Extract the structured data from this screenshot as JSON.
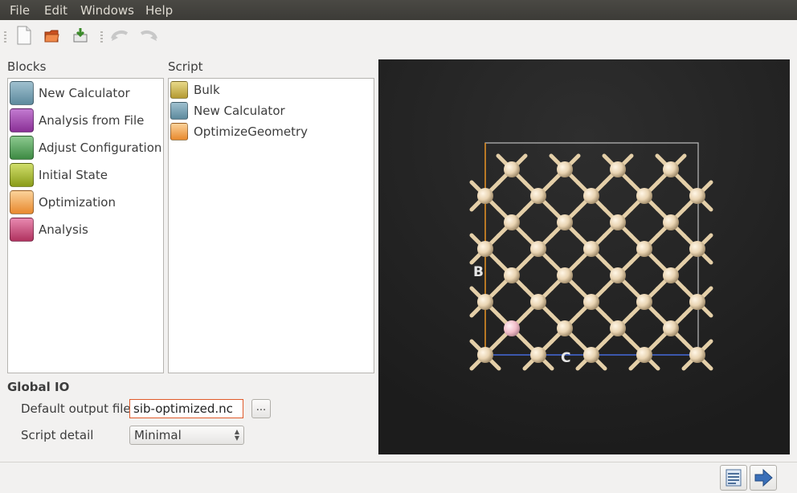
{
  "menu": {
    "file": "File",
    "edit": "Edit",
    "windows": "Windows",
    "help": "Help"
  },
  "toolbar": {
    "new_icon": "new-file-icon",
    "open_icon": "open-folder-icon",
    "save_icon": "save-icon",
    "undo_icon": "undo-icon",
    "redo_icon": "redo-icon"
  },
  "blocks": {
    "title": "Blocks",
    "items": [
      {
        "label": "New Calculator",
        "icon": "calculator-icon",
        "color": "#6f96a8"
      },
      {
        "label": "Analysis from File",
        "icon": "analysis-file-icon",
        "color": "#9b45a8"
      },
      {
        "label": "Adjust Configuration",
        "icon": "adjust-config-icon",
        "color": "#5aa25f"
      },
      {
        "label": "Initial State",
        "icon": "initial-state-icon",
        "color": "#a6b82a"
      },
      {
        "label": "Optimization",
        "icon": "optimization-icon",
        "color": "#f0a24a"
      },
      {
        "label": "Analysis",
        "icon": "analysis-icon",
        "color": "#c9457a"
      }
    ]
  },
  "script": {
    "title": "Script",
    "items": [
      {
        "label": "Bulk",
        "icon": "bulk-icon",
        "color": "#c8b050"
      },
      {
        "label": "New Calculator",
        "icon": "calculator-icon",
        "color": "#6f96a8"
      },
      {
        "label": "OptimizeGeometry",
        "icon": "optimization-icon",
        "color": "#f0a24a"
      }
    ]
  },
  "viewer": {
    "axis_b": "B",
    "axis_c": "C"
  },
  "global_io": {
    "title": "Global IO",
    "output_label": "Default output file",
    "output_value": "sib-optimized.nc",
    "browse_label": "...",
    "detail_label": "Script detail",
    "detail_value": "Minimal"
  },
  "status": {
    "editor_icon": "script-editor-icon",
    "send_icon": "send-arrow-icon"
  }
}
